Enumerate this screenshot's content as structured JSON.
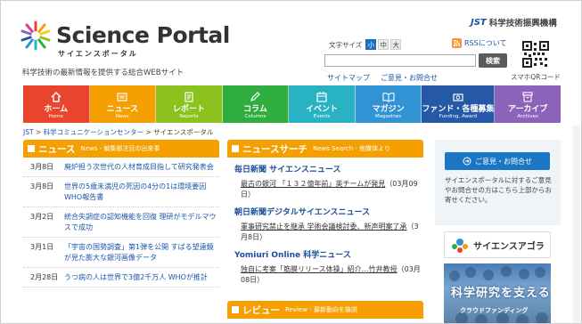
{
  "header": {
    "logo_text": "Science Portal",
    "logo_sub": "サイエンスポータル",
    "tagline": "科学技術の最新情報を提供する総合WEBサイト",
    "jst_mark": "JST",
    "jst_name": "科学技術振興機構",
    "font_size_label": "文字サイズ",
    "font_sizes": [
      "小",
      "中",
      "大"
    ],
    "rss_label": "RSSについて",
    "search_placeholder": "",
    "search_button": "検索",
    "sitemap": "サイトマップ",
    "contact": "ご意見・お問合せ",
    "qr_label": "スマホQRコード"
  },
  "nav": [
    {
      "ja": "ホーム",
      "en": "Home",
      "color": "#e8452c",
      "icon": "home-icon"
    },
    {
      "ja": "ニュース",
      "en": "News",
      "color": "#f5a000",
      "icon": "news-icon"
    },
    {
      "ja": "レポート",
      "en": "Reports",
      "color": "#8cc21e",
      "icon": "report-icon"
    },
    {
      "ja": "コラム",
      "en": "Columns",
      "color": "#2fae3f",
      "icon": "pencil-icon"
    },
    {
      "ja": "イベント",
      "en": "Events",
      "color": "#29b2c4",
      "icon": "event-icon"
    },
    {
      "ja": "マガジン",
      "en": "Magazines",
      "color": "#3192d4",
      "icon": "book-icon"
    },
    {
      "ja": "ファンド・各種募集",
      "en": "Funding, Award",
      "color": "#2559a8",
      "icon": "fund-icon"
    },
    {
      "ja": "アーカイブ",
      "en": "Archives",
      "color": "#8b63b8",
      "icon": "archive-icon"
    }
  ],
  "breadcrumb": {
    "items": [
      "JST",
      "科学コミュニケーションセンター",
      "サイエンスポータル"
    ],
    "separator": ">"
  },
  "news": {
    "title": "ニュース",
    "subtitle": "News - 編集部注目の出来事",
    "items": [
      {
        "date": "3月8日",
        "title": "廃炉担う次世代の人材育成目指して研究発表会"
      },
      {
        "date": "3月8日",
        "title": "世界の5歳未満児の死因の4分の1は環境要因 WHO報告書"
      },
      {
        "date": "3月2日",
        "title": "統合失調症の認知機能を回復 理研がモデルマウスで成功"
      },
      {
        "date": "3月1日",
        "title": "「宇宙の国勢調査」第1弾を公開 すばる望遠鏡が見た膨大な銀河画像データ"
      },
      {
        "date": "2月28日",
        "title": "うつ病の人は世界で3億2千万人 WHOが推計"
      }
    ]
  },
  "news_search": {
    "title": "ニュースサーチ",
    "subtitle": "News Search - 他媒体より",
    "sources": [
      {
        "name": "毎日新聞 サイエンスニュース",
        "items": [
          {
            "text": "最古の銀河 「１３２億年前」英チームが発見",
            "date": "（03月09日）"
          }
        ]
      },
      {
        "name": "朝日新聞デジタルサイエンスニュース",
        "items": [
          {
            "text": "軍事研究禁止を継承 学術会議検討委、新声明案了承",
            "date": "（3月8日）"
          }
        ]
      },
      {
        "name": "Yomiuri Online 科学ニュース",
        "items": [
          {
            "text": "独自に考案「筋膜リリース体操」紹介…竹井教授",
            "date": "（03月08日）"
          }
        ]
      }
    ]
  },
  "review": {
    "title": "レビュー",
    "subtitle": "Review - 最新動向を論説"
  },
  "right": {
    "contact_button": "ご意見・お問合せ",
    "contact_text": "サイエンスポータルに対するご意見やお問合せの方はこちら上部からお寄せください。",
    "sa_banner": "サイエンスアゴラ",
    "cf_title": "科学研究を支える",
    "cf_sub": "クラウドファンディング"
  }
}
